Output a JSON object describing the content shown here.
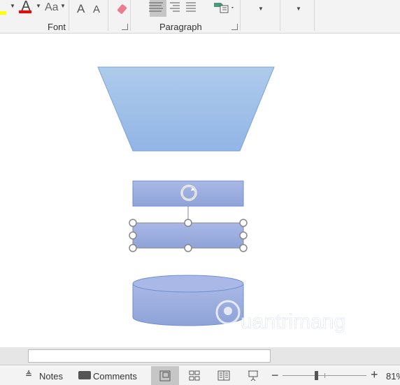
{
  "ribbon": {
    "groups": [
      {
        "label": "Font"
      },
      {
        "label": "Paragraph"
      }
    ],
    "font_buttons": {
      "change_case": "Aa",
      "grow": "A",
      "shrink": "A",
      "font_color": "A"
    },
    "colors": {
      "highlight": "#ffff00",
      "font_color": "#ff0000"
    }
  },
  "status": {
    "notes": "Notes",
    "comments": "Comments",
    "zoom": "81%"
  },
  "watermark": "Quantrimang",
  "colors": {
    "shape_fill_top": "#aecbeb",
    "shape_fill_bottom": "#8fa3d8",
    "outline": "#6f8fcf"
  }
}
